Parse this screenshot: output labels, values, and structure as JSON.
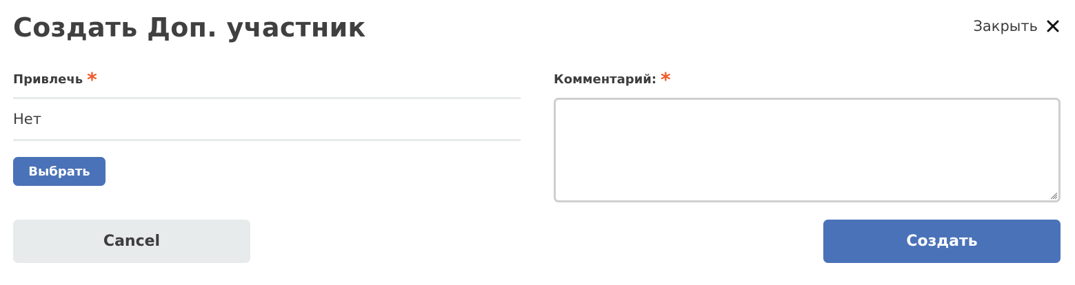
{
  "dialog": {
    "title": "Создать Доп. участник",
    "close_label": "Закрыть",
    "close_icon": "close-icon"
  },
  "involve_field": {
    "label": "Привлечь",
    "required_mark": "*",
    "value": "Нет",
    "choose_button_label": "Выбрать"
  },
  "comment_field": {
    "label": "Комментарий:",
    "required_mark": "*",
    "value": ""
  },
  "actions": {
    "cancel_label": "Cancel",
    "create_label": "Создать"
  },
  "colors": {
    "primary": "#4a72b8",
    "required": "#f05a28",
    "secondary_button_bg": "#e8ebec",
    "text": "#3d3d3d"
  }
}
